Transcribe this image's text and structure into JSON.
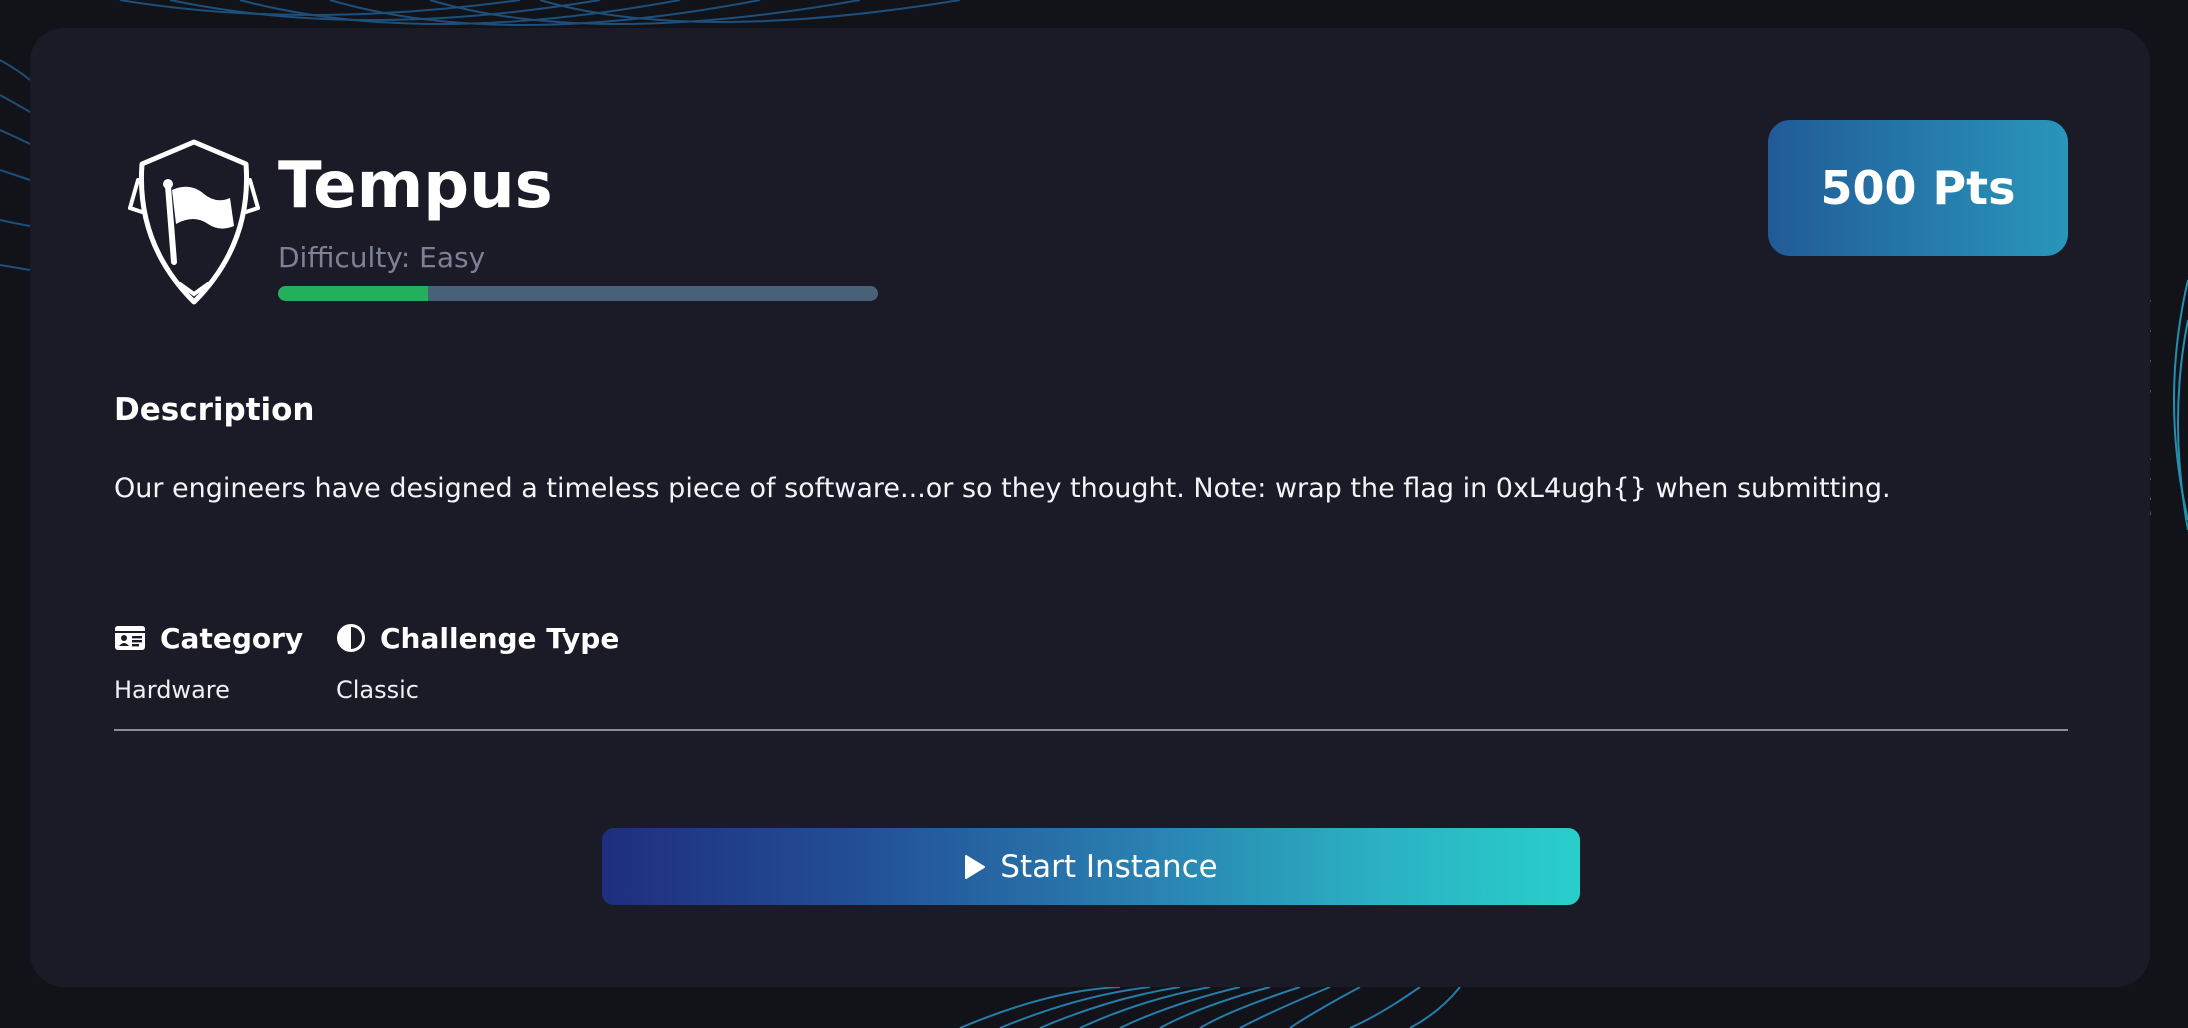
{
  "challenge": {
    "name": "Tempus",
    "difficulty_label": "Difficulty: Easy",
    "difficulty_progress": 0.25,
    "points_label": "500 Pts",
    "logo_icon": "shield-flag-icon"
  },
  "description": {
    "heading": "Description",
    "text": "Our engineers have designed a timeless piece of software...or so they thought. Note: wrap the flag in 0xL4ugh{} when submitting."
  },
  "meta": {
    "category": {
      "label": "Category",
      "value": "Hardware",
      "icon": "id-card-icon"
    },
    "challenge_type": {
      "label": "Challenge Type",
      "value": "Classic",
      "icon": "half-circle-icon"
    }
  },
  "actions": {
    "start_label": "Start Instance",
    "start_icon": "play-icon"
  },
  "colors": {
    "card_bg": "#1b1b28",
    "progress_fill": "#23b05c",
    "progress_track": "#486179",
    "accent_start": "#1f2e7e",
    "accent_end": "#28cfcb"
  }
}
